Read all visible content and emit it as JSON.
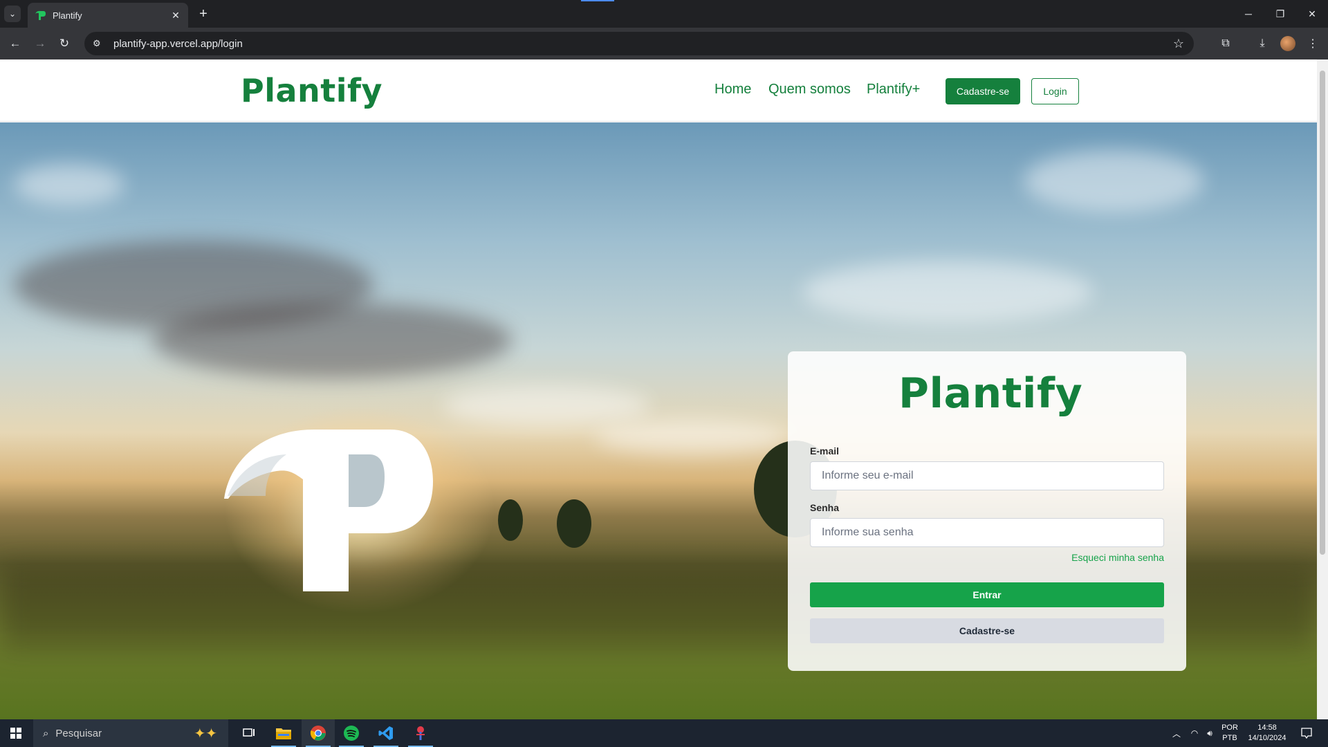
{
  "browser": {
    "tab_title": "Plantify",
    "url": "plantify-app.vercel.app/login"
  },
  "header": {
    "logo": "Plantify",
    "nav": [
      "Home",
      "Quem somos",
      "Plantify+"
    ],
    "signup_label": "Cadastre-se",
    "login_label": "Login"
  },
  "login_form": {
    "logo": "Plantify",
    "email_label": "E-mail",
    "email_placeholder": "Informe seu e-mail",
    "password_label": "Senha",
    "password_placeholder": "Informe sua senha",
    "forgot_label": "Esqueci minha senha",
    "submit_label": "Entrar",
    "signup_label": "Cadastre-se"
  },
  "taskbar": {
    "search_placeholder": "Pesquisar",
    "language_top": "POR",
    "language_bottom": "PTB",
    "time": "14:58",
    "date": "14/10/2024"
  },
  "colors": {
    "brand_green": "#15803d",
    "button_green": "#16a34a"
  }
}
